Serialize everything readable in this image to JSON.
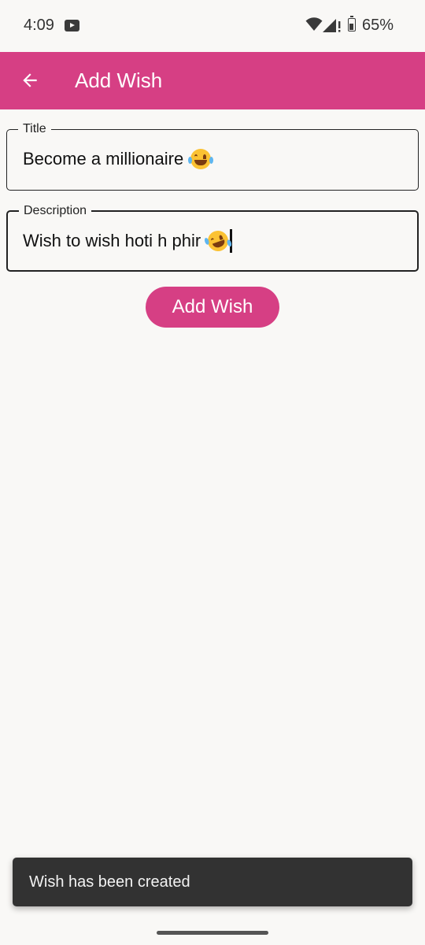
{
  "status_bar": {
    "time": "4:09",
    "battery": "65%",
    "battery_level": 0.65,
    "icons": [
      "youtube-notification-icon",
      "wifi-icon",
      "signal-icon",
      "battery-icon"
    ]
  },
  "app_bar": {
    "title": "Add Wish",
    "back_icon": "arrow-back-icon",
    "color": "#d63f84"
  },
  "form": {
    "title_label": "Title",
    "title_value": "Become a millionaire",
    "title_emoji": "face-with-tears-of-joy-emoji",
    "description_label": "Description",
    "description_value": "Wish to wish hoti h phir",
    "description_emoji": "rolling-on-the-floor-laughing-emoji"
  },
  "actions": {
    "add_wish_label": "Add Wish"
  },
  "snackbar": {
    "message": "Wish has been created"
  }
}
